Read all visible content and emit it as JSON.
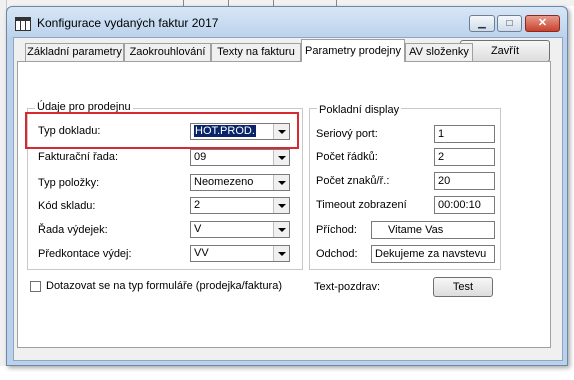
{
  "window": {
    "title": "Konfigurace vydaných faktur  2017",
    "minimize_glyph": "▁",
    "maximize_glyph": "□",
    "close_glyph": "✕"
  },
  "toolbar": {
    "close_label": "Zavřít"
  },
  "tabs": [
    {
      "label": "Základní parametry",
      "active": false
    },
    {
      "label": "Zaokrouhlování",
      "active": false
    },
    {
      "label": "Texty na fakturu",
      "active": false
    },
    {
      "label": "Parametry prodejny",
      "active": true
    },
    {
      "label": "AV složenky",
      "active": false
    }
  ],
  "sale_group": {
    "title": "Údaje pro prodejnu",
    "rows": [
      {
        "label": "Typ dokladu:",
        "value": "HOT.PROD."
      },
      {
        "label": "Fakturační  řada:",
        "value": "09"
      },
      {
        "label": "Typ položky:",
        "value": "Neomezeno"
      },
      {
        "label": "Kód skladu:",
        "value": "2"
      },
      {
        "label": "Řada výdejek:",
        "value": "V"
      },
      {
        "label": "Předkontace výdej:",
        "value": "VV"
      }
    ]
  },
  "display_group": {
    "title": "Pokladní display",
    "rows": [
      {
        "label": "Seriový port:",
        "value": "1"
      },
      {
        "label": "Počet řádků:",
        "value": "2"
      },
      {
        "label": "Počet znaků/ř.:",
        "value": "20"
      },
      {
        "label": "Timeout zobrazení",
        "value": "00:00:10"
      },
      {
        "label": "Příchod:",
        "value": "Vitame Vas"
      },
      {
        "label": "Odchod:",
        "value": "Dekujeme za navstevu"
      }
    ]
  },
  "checkbox": {
    "label": "Dotazovat se na typ formuláře (prodejka/faktura)",
    "checked": false
  },
  "text_greeting": {
    "label": "Text-pozdrav:",
    "button": "Test"
  },
  "colors": {
    "highlight": "#d9282f",
    "selection": "#0a246a",
    "title_bar": "#bcd3ec"
  }
}
